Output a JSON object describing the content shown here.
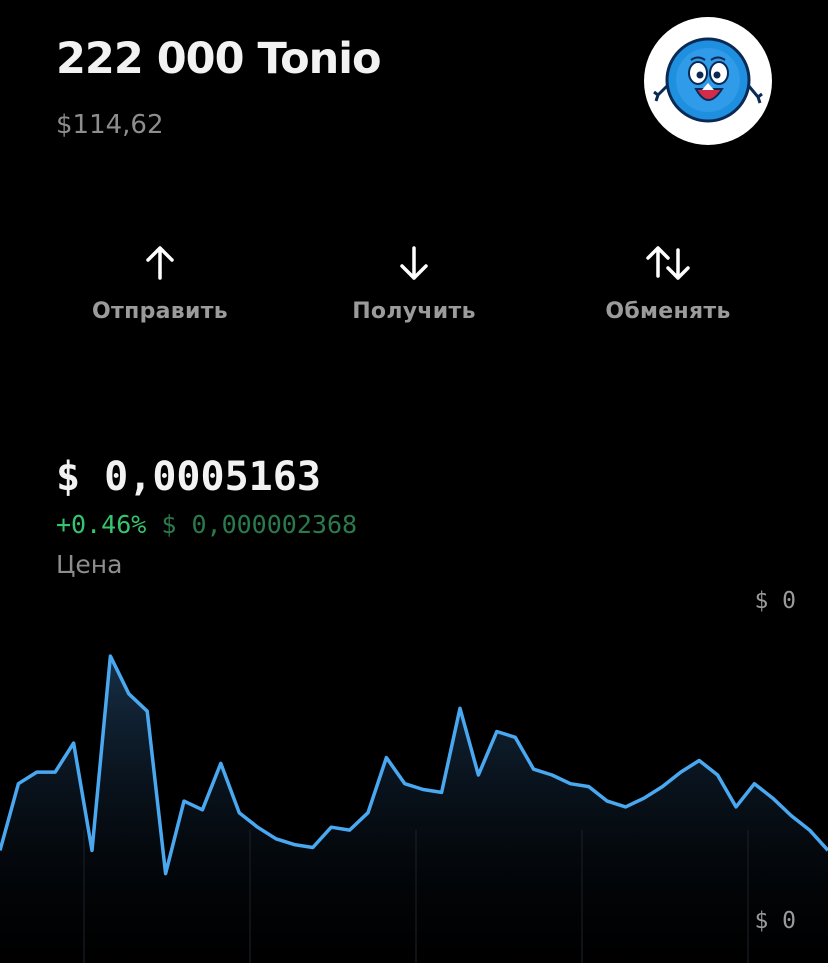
{
  "token": {
    "balance": "222 000 Tonio",
    "fiat_value": "$114,62",
    "avatar_icon": "cartoon-coin-mascot-icon"
  },
  "actions": [
    {
      "label": "Отправить",
      "icon": "arrow-up-icon"
    },
    {
      "label": "Получить",
      "icon": "arrow-down-icon"
    },
    {
      "label": "Обменять",
      "icon": "swap-arrows-icon"
    }
  ],
  "price": {
    "value": "$ 0,0005163",
    "change_percent": "+0.46%",
    "change_abs": "$ 0,000002368",
    "label": "Цена"
  },
  "colors": {
    "background": "#000000",
    "line": "#4aa8f0",
    "positive": "#35c56f",
    "positive_dim": "#2b7a4b",
    "muted": "#8d8d8d"
  },
  "chart_data": {
    "type": "area",
    "y_axis_labels": {
      "max": "$ 0",
      "min": "$ 0"
    },
    "grid": "vertical-lines",
    "values": [
      0.24,
      0.47,
      0.51,
      0.51,
      0.61,
      0.24,
      0.91,
      0.78,
      0.72,
      0.16,
      0.41,
      0.38,
      0.54,
      0.37,
      0.32,
      0.28,
      0.26,
      0.25,
      0.32,
      0.31,
      0.37,
      0.56,
      0.47,
      0.45,
      0.44,
      0.73,
      0.5,
      0.65,
      0.63,
      0.52,
      0.5,
      0.47,
      0.46,
      0.41,
      0.39,
      0.42,
      0.46,
      0.51,
      0.55,
      0.5,
      0.39,
      0.47,
      0.42,
      0.36,
      0.31,
      0.24
    ]
  }
}
